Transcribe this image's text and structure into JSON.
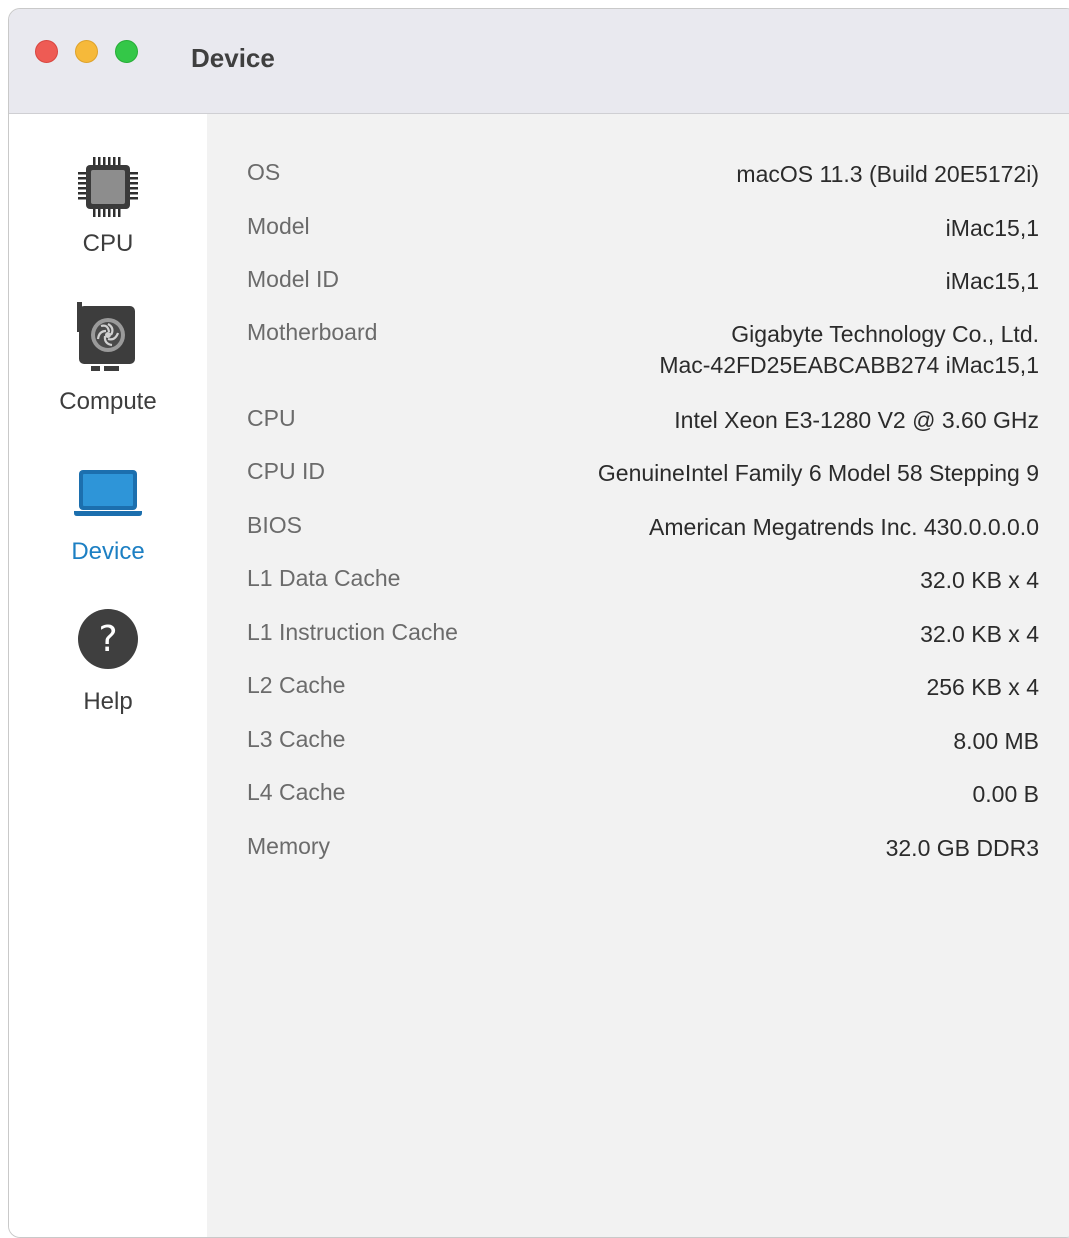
{
  "window": {
    "title": "Device"
  },
  "sidebar": {
    "items": [
      {
        "label": "CPU",
        "icon": "cpu-chip-icon"
      },
      {
        "label": "Compute",
        "icon": "gpu-card-icon"
      },
      {
        "label": "Device",
        "icon": "laptop-icon",
        "active": true
      },
      {
        "label": "Help",
        "icon": "help-icon"
      }
    ],
    "active_color": "#1c7fc3"
  },
  "device_info": {
    "rows": [
      {
        "key": "OS",
        "value": "macOS 11.3 (Build 20E5172i)"
      },
      {
        "key": "Model",
        "value": "iMac15,1"
      },
      {
        "key": "Model ID",
        "value": "iMac15,1"
      },
      {
        "key": "Motherboard",
        "value": "Gigabyte Technology Co., Ltd.",
        "value_line2": "Mac-42FD25EABCABB274 iMac15,1"
      },
      {
        "key": "CPU",
        "value": "Intel Xeon E3-1280 V2 @ 3.60 GHz"
      },
      {
        "key": "CPU ID",
        "value": "GenuineIntel Family 6 Model 58 Stepping 9"
      },
      {
        "key": "BIOS",
        "value": "American Megatrends Inc. 430.0.0.0.0"
      },
      {
        "key": "L1 Data Cache",
        "value": "32.0 KB x 4"
      },
      {
        "key": "L1 Instruction Cache",
        "value": "32.0 KB x 4"
      },
      {
        "key": "L2 Cache",
        "value": "256 KB x 4"
      },
      {
        "key": "L3 Cache",
        "value": "8.00 MB"
      },
      {
        "key": "L4 Cache",
        "value": "0.00 B"
      },
      {
        "key": "Memory",
        "value": "32.0 GB DDR3"
      }
    ]
  }
}
